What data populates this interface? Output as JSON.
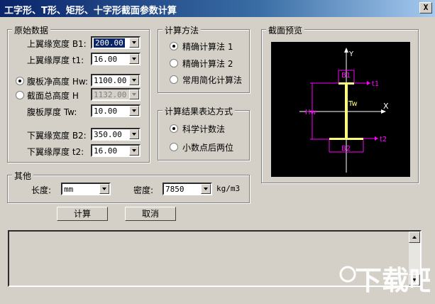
{
  "window": {
    "title": "工字形、T形、矩形、十字形截面参数计算",
    "close_glyph": "X"
  },
  "params": {
    "legend": "原始数据",
    "top_flange_width": {
      "label": "上翼缘宽度 B1:",
      "value": "200.00"
    },
    "top_flange_thickness": {
      "label": "上翼缘厚度 t1:",
      "value": "16.00"
    },
    "web_net_height": {
      "label": "腹板净高度 Hw:",
      "value": "1100.00",
      "selected": true
    },
    "section_total_height": {
      "label": "截面总高度 H",
      "value": "1132.00",
      "selected": false
    },
    "web_thickness": {
      "label": "腹板厚度  Tw:",
      "value": "10.00"
    },
    "bottom_flange_width": {
      "label": "下翼缘宽度 B2:",
      "value": "350.00"
    },
    "bottom_flange_thickness": {
      "label": "下翼缘厚度 t2:",
      "value": "16.00"
    }
  },
  "method": {
    "legend": "计算方法",
    "options": [
      "精确计算法 1",
      "精确计算法 2",
      "常用简化计算法"
    ],
    "selected": 0
  },
  "result_format": {
    "legend": "计算结果表达方式",
    "options": [
      "科学计数法",
      "小数点后两位"
    ],
    "selected": 0
  },
  "preview": {
    "legend": "截面预览",
    "labels": {
      "y": "Y",
      "x": "X",
      "b1": "B1",
      "b2": "B2",
      "t1": "t1",
      "t2": "t2",
      "hw": "Hw",
      "tw": "Tw"
    },
    "colors": {
      "background": "#000000",
      "beam": "#ffff80",
      "dimension": "#ff00ff",
      "axis": "#ffffff"
    }
  },
  "other": {
    "legend": "其他",
    "length_label": "长度:",
    "length_unit": "mm",
    "density_label": "密度:",
    "density_value": "7850",
    "density_unit": "kg/m3"
  },
  "buttons": {
    "calculate": "计算",
    "cancel": "取消"
  },
  "output": {
    "text": ""
  },
  "watermark": {
    "text": "下载吧"
  }
}
